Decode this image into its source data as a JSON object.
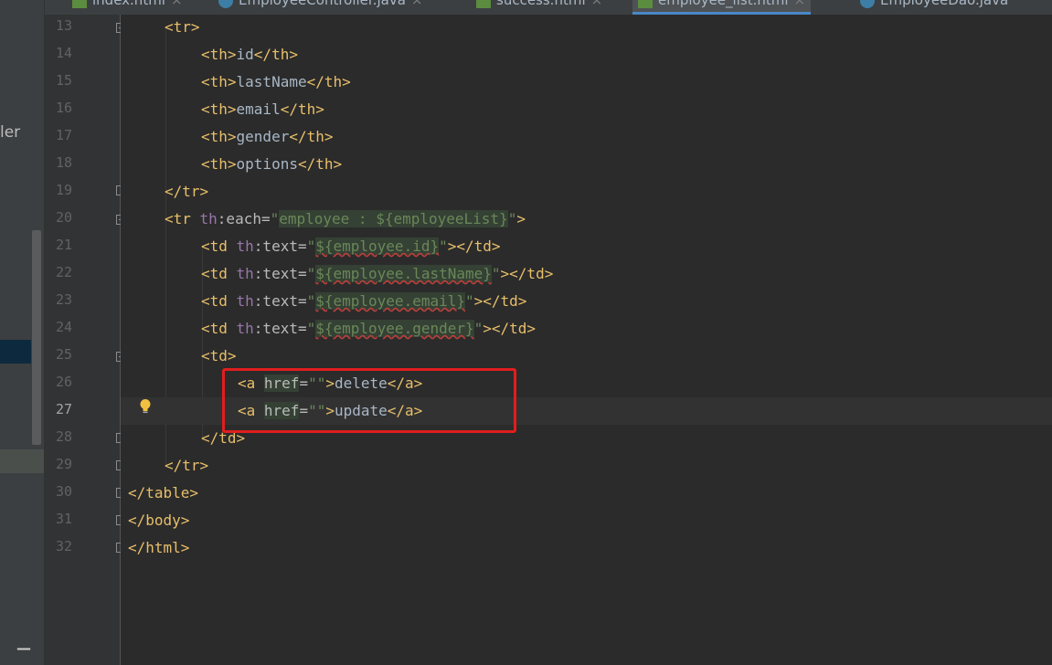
{
  "left_panel": {
    "partial_label": "ler"
  },
  "tabs": [
    {
      "label": "index.html",
      "icon": "html-file-icon"
    },
    {
      "label": "EmployeeController.java",
      "icon": "java-class-icon"
    },
    {
      "label": "success.html",
      "icon": "html-file-icon"
    },
    {
      "label": "employee_list.html",
      "icon": "html-file-icon",
      "active": true
    },
    {
      "label": "EmployeeDao.java",
      "icon": "java-class-icon"
    }
  ],
  "editor": {
    "line_numbers": [
      "13",
      "14",
      "15",
      "16",
      "17",
      "18",
      "19",
      "20",
      "21",
      "22",
      "23",
      "24",
      "25",
      "26",
      "27",
      "28",
      "29",
      "30",
      "31",
      "32"
    ],
    "lines": {
      "l13": "<tr>",
      "l14_content": "id",
      "l15_content": "lastName",
      "l16_content": "email",
      "l17_content": "gender",
      "l18_content": "options",
      "l20_expr": "employee : ${employeeList}",
      "l21_expr": "${employee.id}",
      "l22_expr": "${employee.lastName}",
      "l23_expr": "${employee.email}",
      "l24_expr": "${employee.gender}",
      "l26_text": "delete",
      "l27_text": "update"
    },
    "current_line": "27"
  },
  "colors": {
    "background": "#2b2b2b",
    "tag": "#e8bf6a",
    "string": "#6a8759",
    "namespace": "#9876aa",
    "highlight_box": "#e01e1e",
    "active_tab_underline": "#4a88c7"
  }
}
